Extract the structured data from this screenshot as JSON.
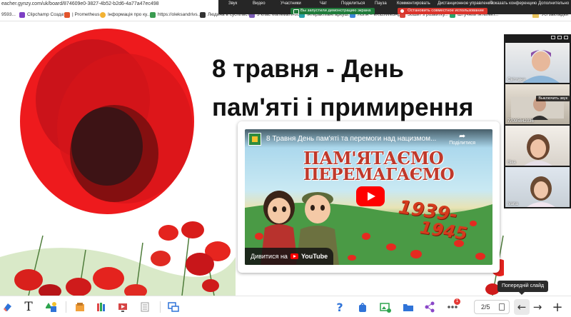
{
  "browser": {
    "url": "eacher.gynzy.com/uk/board/874609e0-3827-4b52-b2d6-4a77a47ec498",
    "bookmarks": [
      {
        "label": "9593...",
        "color": "#4a7bd0"
      },
      {
        "label": "Clipchamp Создать",
        "color": "#7d3fc4"
      },
      {
        "label": "| Prometheus",
        "color": "#e2542c"
      },
      {
        "label": "Інформація про ку...",
        "color": "#f2b233"
      },
      {
        "label": "https://oleksandrivs...",
        "color": "#3a9b50"
      },
      {
        "label": "Людина в суспільст...",
        "color": "#333333"
      },
      {
        "label": "3 клас Математичн...",
        "color": "#7a5bb5"
      },
      {
        "label": "Інтерактивні аркуш...",
        "color": "#2aa1a8"
      },
      {
        "label": "Логін – eKidsWebApp",
        "color": "#3d86d8"
      },
      {
        "label": "Зошит з розвитку...",
        "color": "#d8463a"
      },
      {
        "label": "Штучний інтелект...",
        "color": "#29a36a"
      }
    ],
    "all_bookmarks": "Усі закладки"
  },
  "conference": {
    "menu": [
      "Звук",
      "Видео",
      "Участники",
      "Чат",
      "Поделиться",
      "Пауза",
      "Комментировать",
      "Дистанционное управление",
      "Показать конференцию",
      "Дополнительно"
    ],
    "demo_notice": "Вы запустили демонстрацию экрана",
    "stop_label": "Остановить совместное использование"
  },
  "slide": {
    "title_line1": "8 травня - День",
    "title_line2": "пам'яті і примирення",
    "video": {
      "title": "8 Травня День пам'яті та перемоги над нацизмом...",
      "share_label": "Поділитися",
      "slogan_line1": "ПАМ'ЯТАЄМО",
      "slogan_line2": "ПЕРЕМАГАЄМО",
      "years_line1": "1939-",
      "years_line2": "1945",
      "watch_on": "Дивитися на",
      "youtube": "YouTube"
    }
  },
  "participants": [
    {
      "name": "Світлана",
      "tip": ""
    },
    {
      "name": "77095842036",
      "tip": "Выключить звук"
    },
    {
      "name": "Віка",
      "tip": ""
    },
    {
      "name": "Ivana",
      "tip": ""
    }
  ],
  "toolbar": {
    "page_indicator": "2/5",
    "tooltip": "Попередній слайд",
    "notification_count": "1",
    "text_tool_glyph": "T",
    "prev_glyph": "←",
    "next_glyph": "→",
    "add_glyph": "+"
  }
}
